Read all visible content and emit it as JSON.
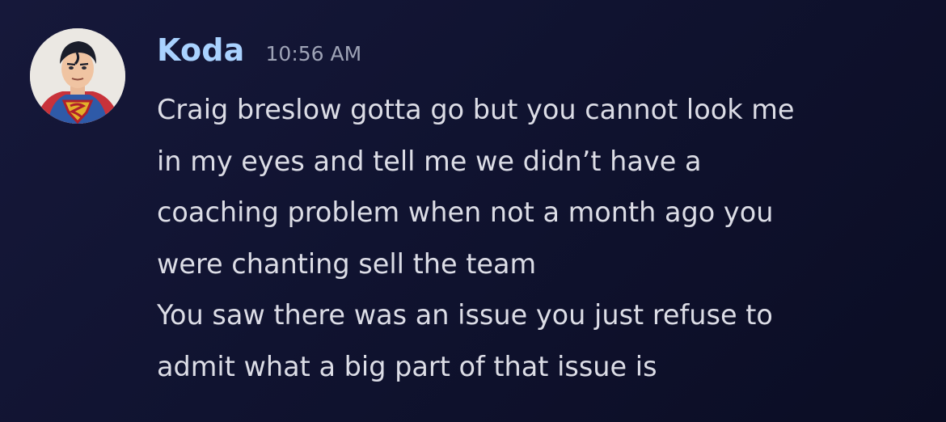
{
  "message": {
    "author": "Koda",
    "timestamp": "10:56 AM",
    "avatar_icon": "superman-avatar-icon",
    "paragraphs": [
      {
        "lines": [
          "Craig breslow gotta go but you cannot look me",
          "in my eyes and tell me we didn’t have a",
          "coaching problem when not a month ago you",
          "were chanting sell the team"
        ]
      },
      {
        "lines": [
          "You saw there was an issue you just refuse to",
          "admit what a big part of that issue is"
        ]
      }
    ]
  },
  "colors": {
    "background": "#111430",
    "username": "#a9d2ff",
    "timestamp": "#9ea3b6",
    "text": "#dcdde6"
  }
}
